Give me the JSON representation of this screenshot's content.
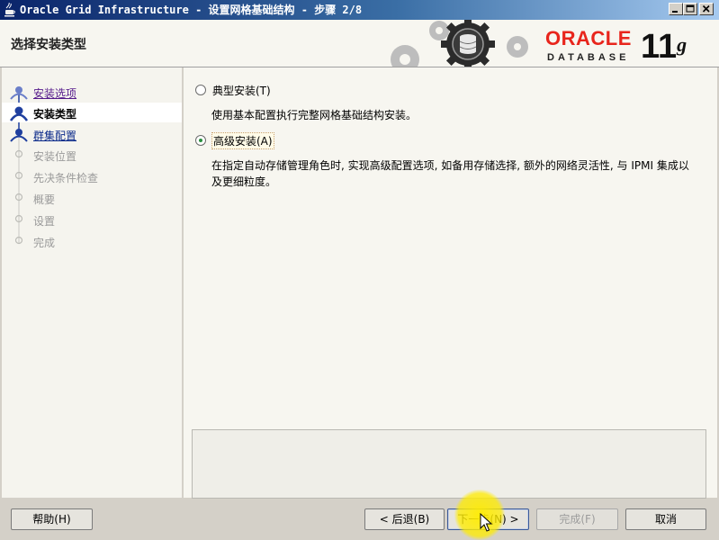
{
  "window": {
    "title": "Oracle Grid Infrastructure - 设置网格基础结构 - 步骤 2/8",
    "controls": {
      "minimize": "minimize",
      "maximize": "maximize",
      "close": "close"
    }
  },
  "header": {
    "page_title": "选择安装类型",
    "logo": {
      "oracle": "ORACLE",
      "database": "DATABASE",
      "version": "11",
      "version_suffix": "g"
    }
  },
  "sidebar": {
    "steps": [
      {
        "label": "安装选项",
        "state": "done"
      },
      {
        "label": "安装类型",
        "state": "current"
      },
      {
        "label": "群集配置",
        "state": "link"
      },
      {
        "label": "安装位置",
        "state": "pending"
      },
      {
        "label": "先决条件检查",
        "state": "pending"
      },
      {
        "label": "概要",
        "state": "pending"
      },
      {
        "label": "设置",
        "state": "pending"
      },
      {
        "label": "完成",
        "state": "pending"
      }
    ]
  },
  "options": {
    "typical": {
      "label": "典型安装(T)",
      "selected": false,
      "description": "使用基本配置执行完整网格基础结构安装。"
    },
    "advanced": {
      "label": "高级安装(A)",
      "selected": true,
      "description": "在指定自动存储管理角色时, 实现高级配置选项, 如备用存储选择, 额外的网络灵活性, 与 IPMI 集成以及更细粒度。"
    }
  },
  "message_box": {
    "text": ""
  },
  "buttons": {
    "help": "帮助(H)",
    "back": "< 后退(B)",
    "next": "下一步(N) >",
    "finish": "完成(F)",
    "cancel": "取消"
  },
  "colors": {
    "oracle_red": "#e8251c",
    "title_bar": "#0a246a",
    "radio_check": "#2a8f3f"
  }
}
